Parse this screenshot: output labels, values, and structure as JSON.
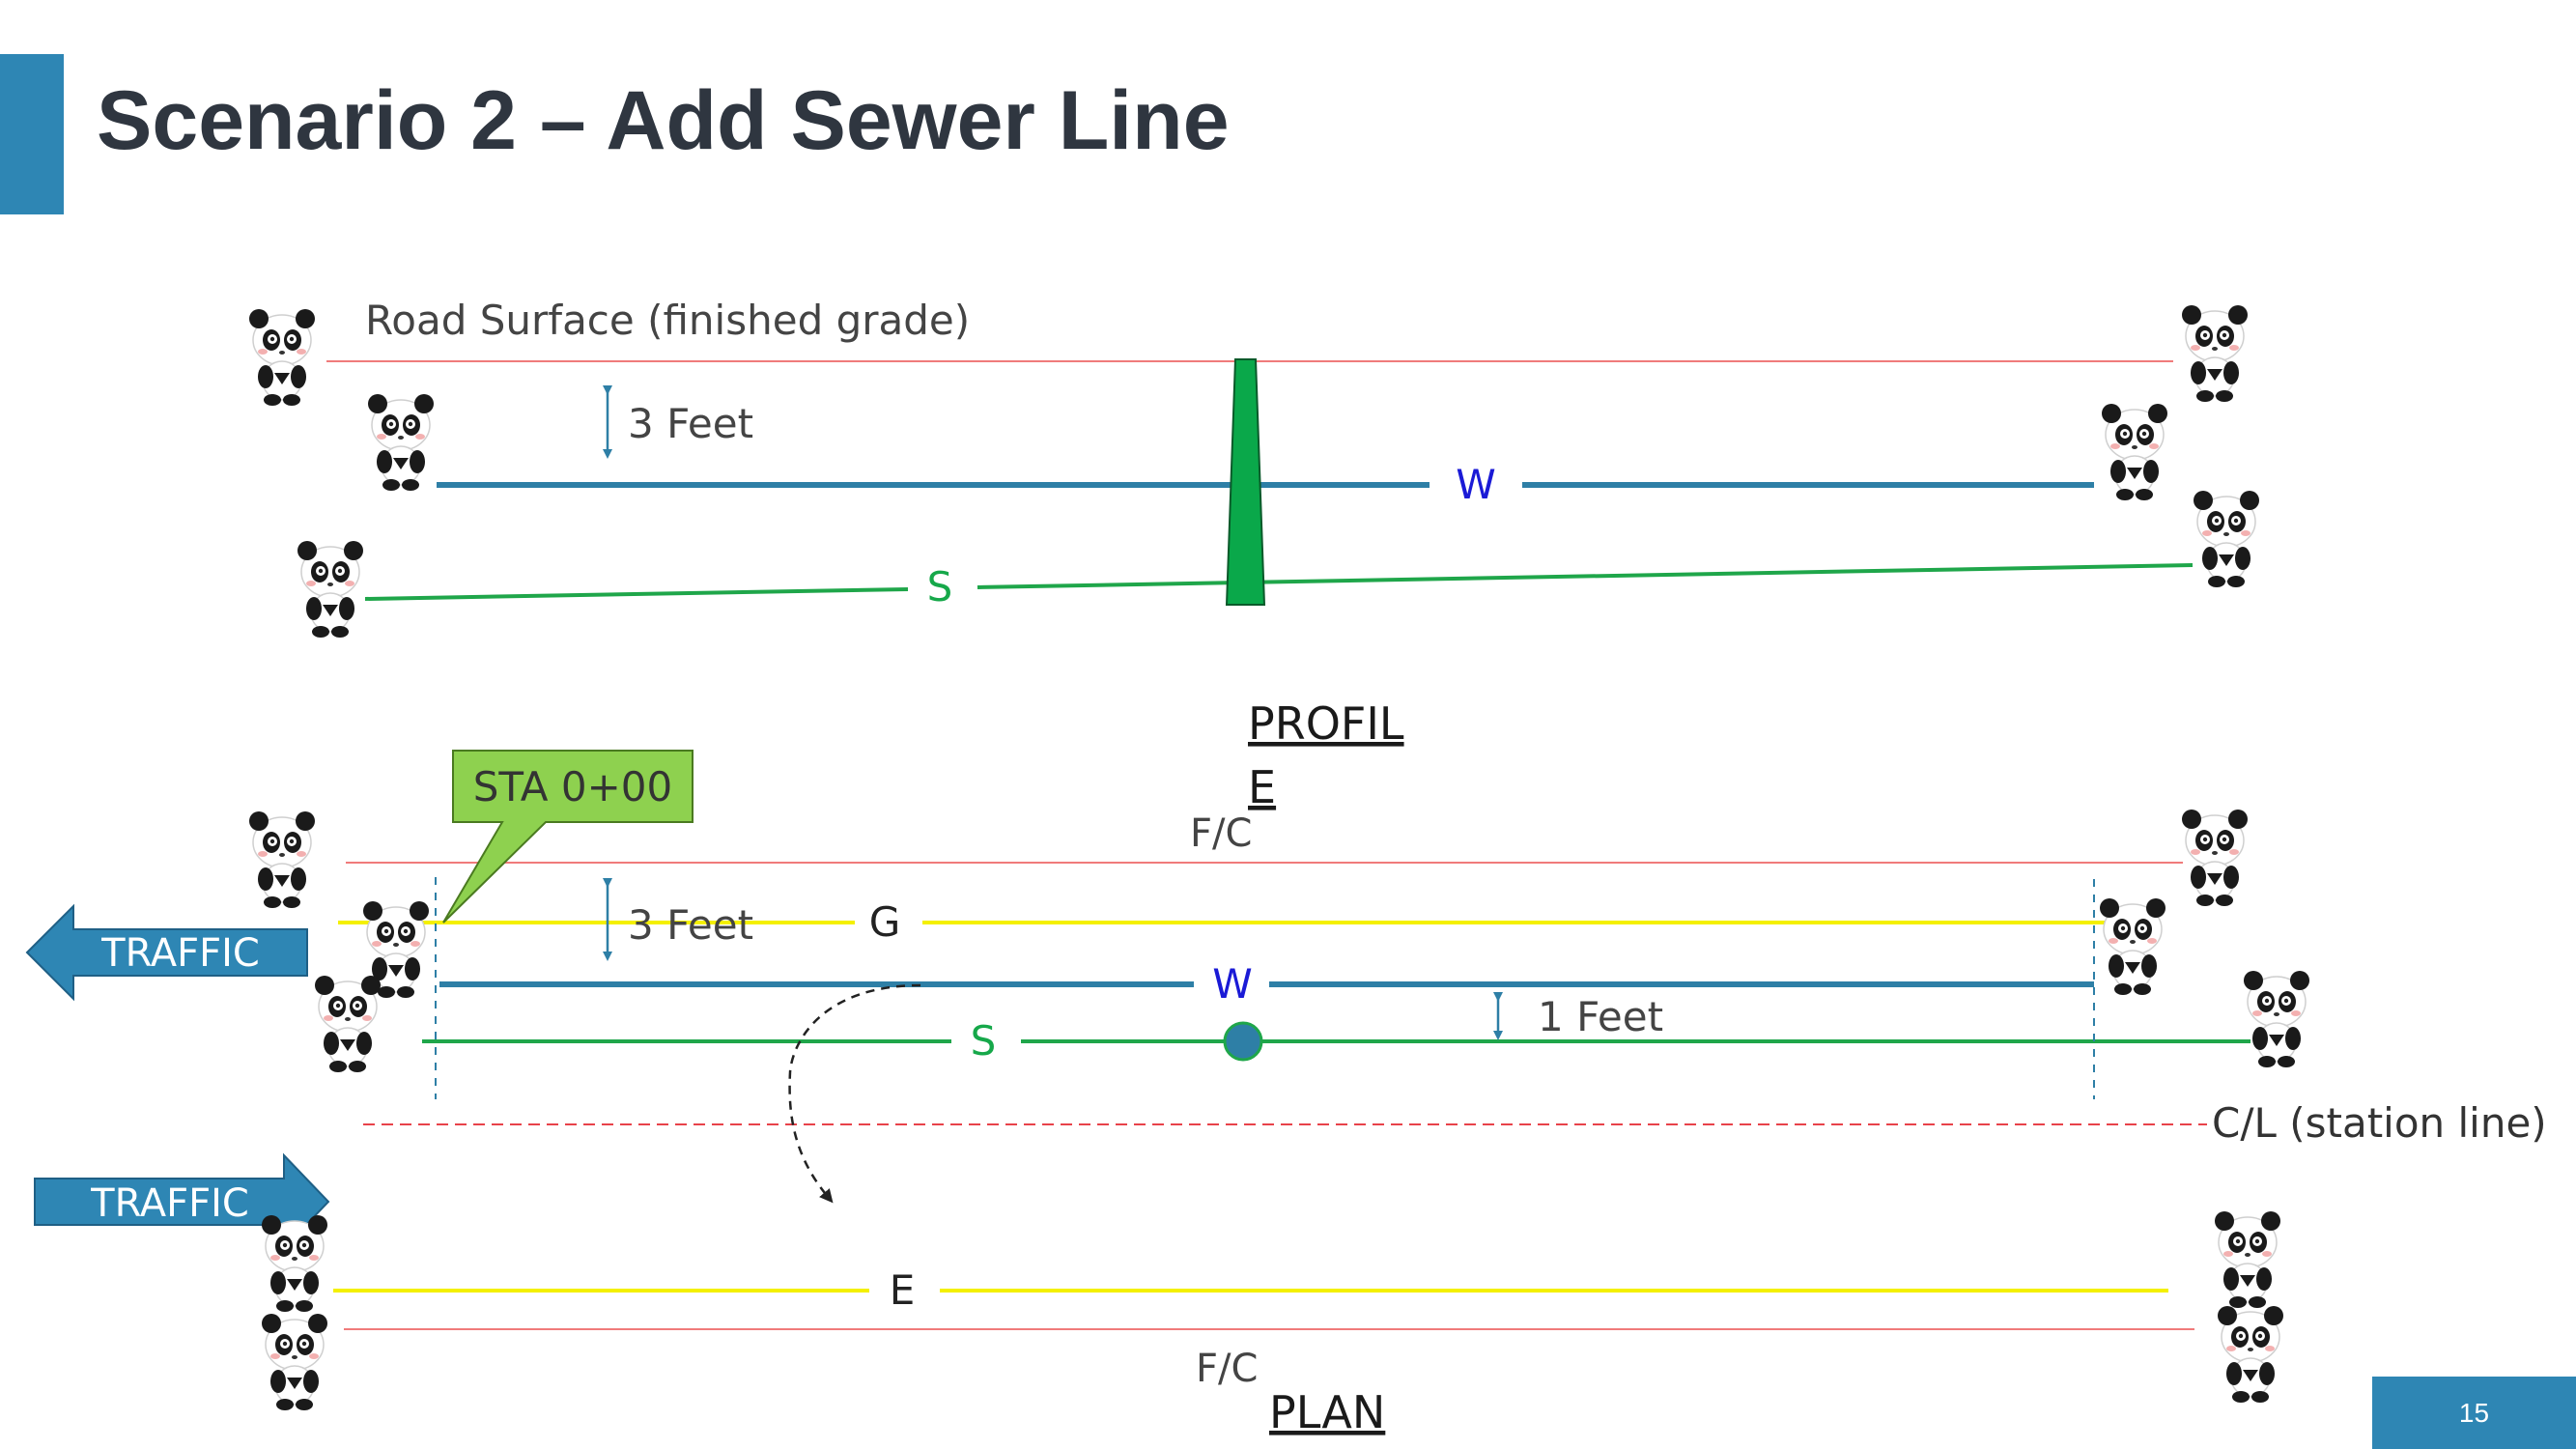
{
  "slide": {
    "title": "Scenario 2 – Add Sewer Line",
    "page_number": "15"
  },
  "profile": {
    "road_surface_label": "Road Surface (finished grade)",
    "depth_label": "3 Feet",
    "water_label": "W",
    "sewer_label": "S",
    "section_label_line1": "PROFIL",
    "section_label_line2": "E"
  },
  "plan": {
    "callout_label": "STA 0+00",
    "top_curb_label": "F/C",
    "depth_label": "3 Feet",
    "gas_label": "G",
    "water_label": "W",
    "sewer_label": "S",
    "separation_label": "1 Feet",
    "centerline_label": "C/L (station line)",
    "traffic_left_label": "TRAFFIC",
    "traffic_right_label": "TRAFFIC",
    "electric_label": "E",
    "bottom_curb_label": "F/C",
    "section_label": "PLAN"
  },
  "colors": {
    "accent": "#2e86b4",
    "title_text": "#2f3640",
    "road_line": "#f07b7b",
    "water_line": "#2e7fa6",
    "sewer_line": "#1fa64a",
    "gas_line": "#f4f000",
    "electric_line": "#f4f000",
    "callout_fill": "#8ed14f",
    "manhole_fill": "#0aa84a",
    "water_text": "#1a1ad6",
    "sewer_text": "#16a84a"
  },
  "icons": [
    "panda-icon",
    "double-arrow-icon",
    "dashed-curve-arrow-icon",
    "manhole-icon",
    "traffic-arrow-left-icon",
    "traffic-arrow-right-icon"
  ]
}
